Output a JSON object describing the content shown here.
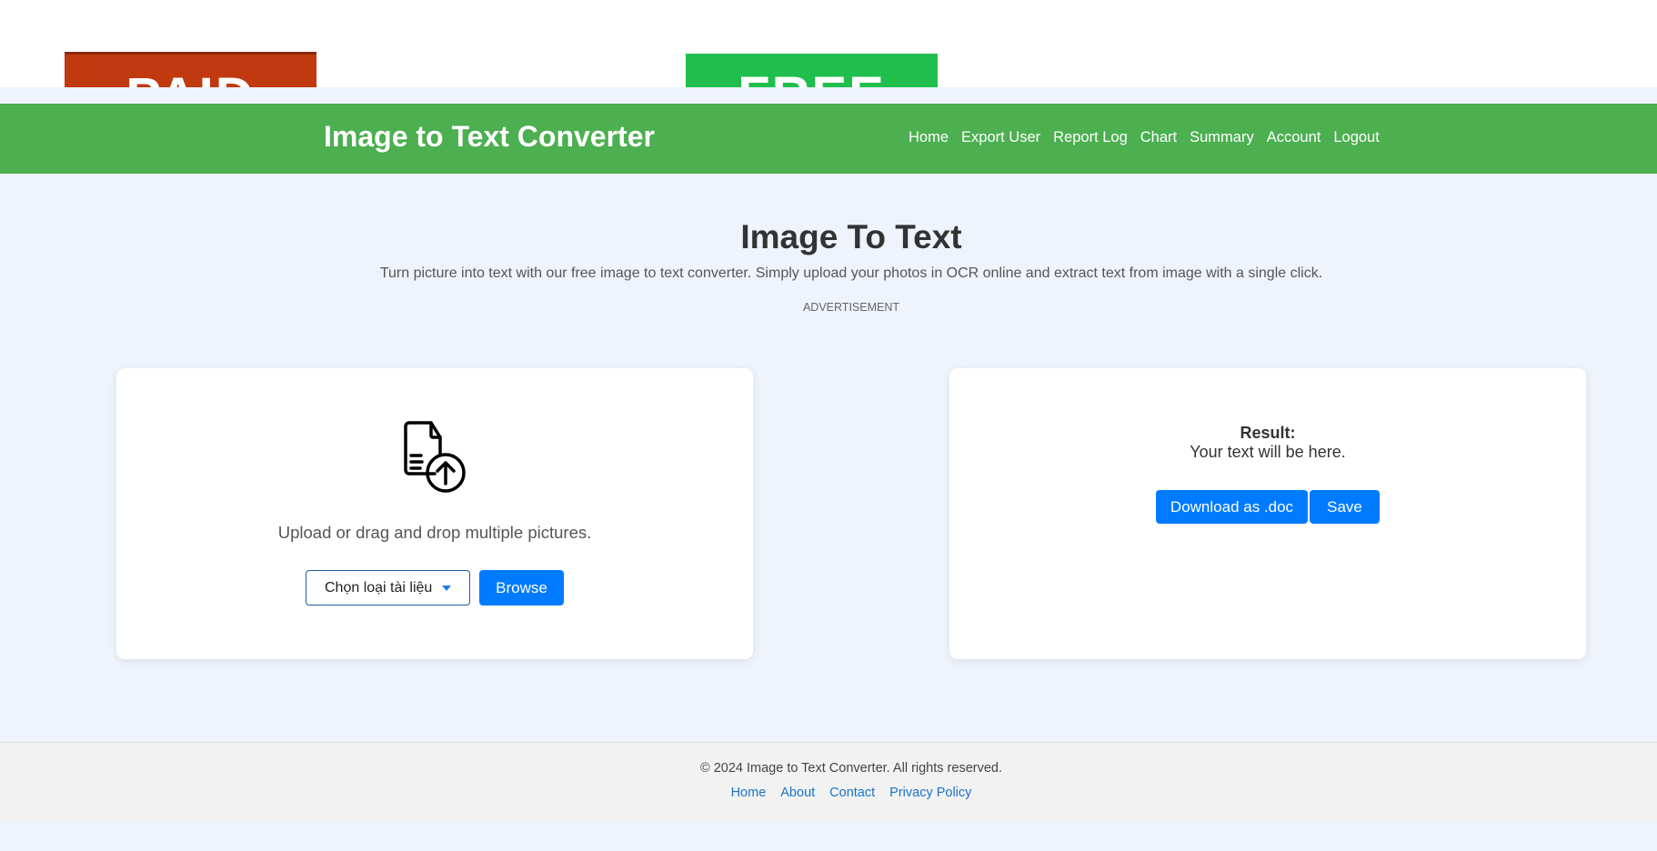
{
  "ads": {
    "paid_text": "PAID",
    "free_text": "FREE",
    "label": "ADVERTISEMENT"
  },
  "header": {
    "title": "Image to Text Converter",
    "nav": [
      "Home",
      "Export User",
      "Report Log",
      "Chart",
      "Summary",
      "Account",
      "Logout"
    ]
  },
  "main": {
    "title": "Image To Text",
    "subtitle": "Turn picture into text with our free image to text converter. Simply upload your photos in OCR online and extract text from image with a single click."
  },
  "upload": {
    "text": "Upload or drag and drop multiple pictures.",
    "select_value": "Chọn loại tài liệu",
    "browse_label": "Browse"
  },
  "result": {
    "label": "Result:",
    "placeholder": "Your text will be here.",
    "download_label": "Download as .doc",
    "save_label": "Save"
  },
  "footer": {
    "copyright": "© 2024 Image to Text Converter. All rights reserved.",
    "links": [
      "Home",
      "About",
      "Contact",
      "Privacy Policy"
    ]
  },
  "colors": {
    "header": "#4caf50",
    "primary": "#007bff",
    "background": "#eef3fc"
  }
}
